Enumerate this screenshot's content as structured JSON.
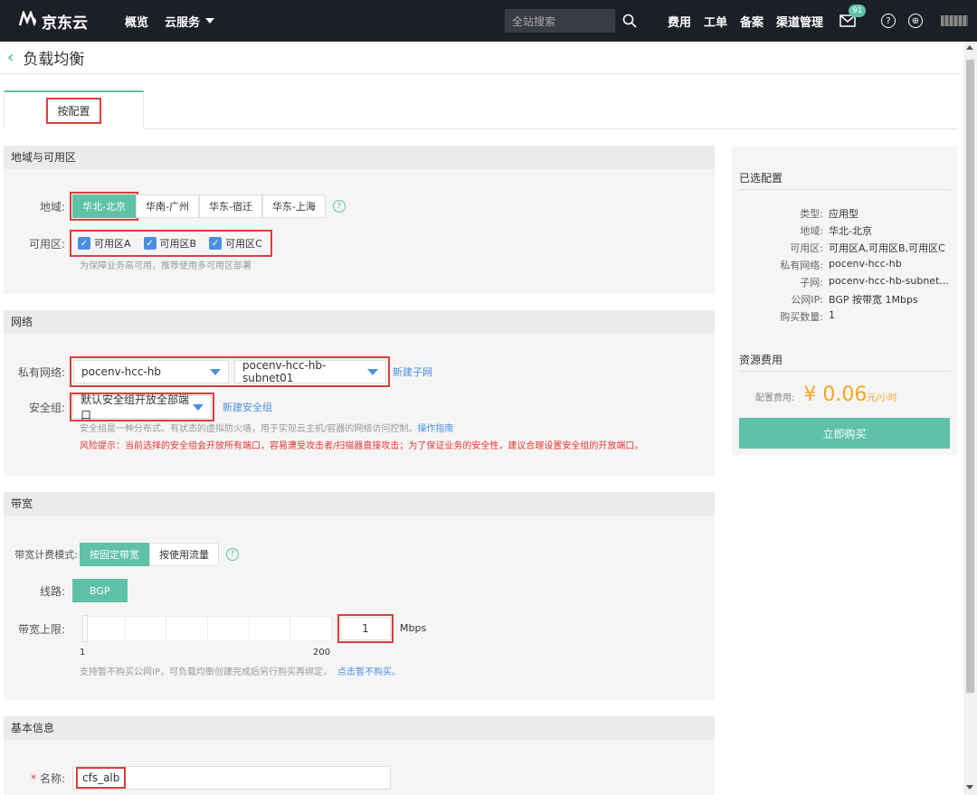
{
  "topbar": {
    "logo_text": "京东云",
    "nav": [
      "概览",
      "云服务"
    ],
    "search_placeholder": "全站搜索",
    "links": [
      "费用",
      "工单",
      "备案",
      "渠道管理"
    ],
    "mail_badge": "91"
  },
  "page": {
    "title": "负载均衡"
  },
  "tabs": [
    {
      "label": "按配置"
    }
  ],
  "region_section": {
    "title": "地域与可用区",
    "region_label": "地域:",
    "regions": [
      "华北-北京",
      "华南-广州",
      "华东-宿迁",
      "华东-上海"
    ],
    "active_region": "华北-北京",
    "az_label": "可用区:",
    "azs": [
      "可用区A",
      "可用区B",
      "可用区C"
    ],
    "az_hint": "为保障业务高可用，推荐使用多可用区部署"
  },
  "network_section": {
    "title": "网络",
    "vpc_label": "私有网络:",
    "vpc_value": "pocenv-hcc-hb",
    "subnet_value": "pocenv-hcc-hb-subnet01",
    "new_subnet": "新建子网",
    "sg_label": "安全组:",
    "sg_value": "默认安全组开放全部端口",
    "new_sg": "新建安全组",
    "sg_hint": "安全组是一种分布式、有状态的虚拟防火墙，用于实现云主机/容器的网络访问控制。",
    "sg_guide": "操作指南",
    "risk": "风险提示：当前选择的安全组会开放所有端口，容易遭受攻击者/扫描器直接攻击；为了保证业务的安全性，建议合理设置安全组的开放端口。"
  },
  "bandwidth_section": {
    "title": "带宽",
    "mode_label": "带宽计费模式:",
    "modes": [
      "按固定带宽",
      "按使用流量"
    ],
    "line_label": "线路:",
    "line_value": "BGP",
    "limit_label": "带宽上限:",
    "limit_value": "1",
    "unit": "Mbps",
    "min": "1",
    "max": "200",
    "note": "支持暂不购买公网IP，可负载均衡创建完成后另行购买再绑定，",
    "note_link": "点击暂不购买。"
  },
  "basic_section": {
    "title": "基本信息",
    "name_label": "名称:",
    "name_value": "cfs_alb",
    "required_mark": "*"
  },
  "summary": {
    "title": "已选配置",
    "rows": [
      {
        "k": "类型:",
        "v": "应用型"
      },
      {
        "k": "地域:",
        "v": "华北-北京"
      },
      {
        "k": "可用区:",
        "v": "可用区A,可用区B,可用区C"
      },
      {
        "k": "私有网络:",
        "v": "pocenv-hcc-hb"
      },
      {
        "k": "子网:",
        "v": "pocenv-hcc-hb-subnet..."
      },
      {
        "k": "公网IP:",
        "v": "BGP 按带宽 1Mbps"
      },
      {
        "k": "购买数量:",
        "v": "1"
      }
    ],
    "fee_title": "资源费用",
    "price_label": "配置费用:",
    "price": "¥ 0.06",
    "price_unit": "元/小时",
    "buy_label": "立即购买"
  }
}
